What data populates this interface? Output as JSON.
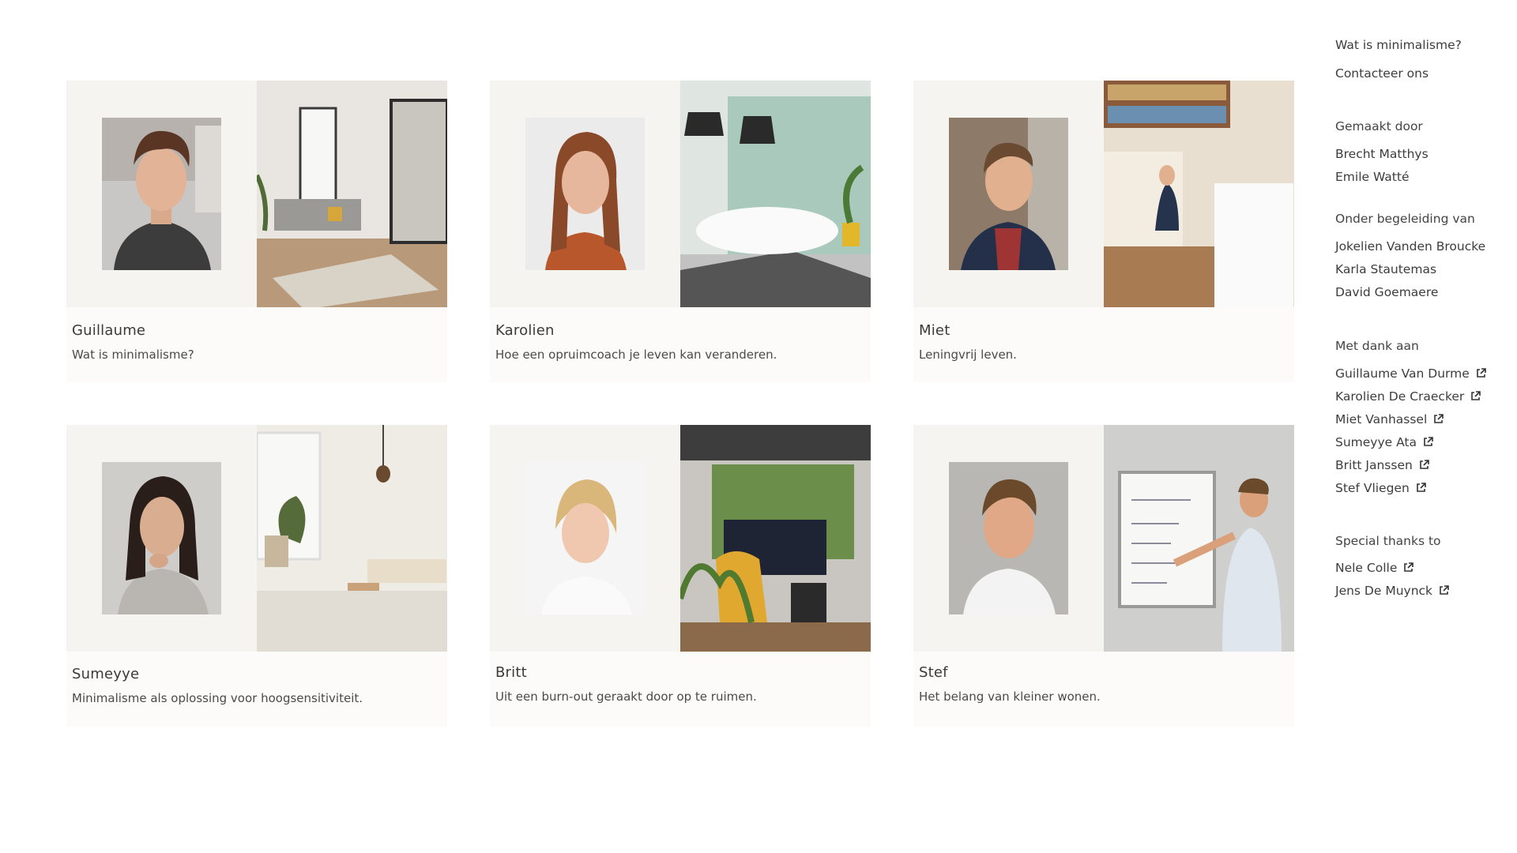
{
  "cards": [
    {
      "name": "Guillaume",
      "subtitle": "Wat is minimalisme?"
    },
    {
      "name": "Karolien",
      "subtitle": "Hoe een opruimcoach je leven kan veranderen."
    },
    {
      "name": "Miet",
      "subtitle": "Leningvrij leven."
    },
    {
      "name": "Sumeyye",
      "subtitle": "Minimalisme als oplossing voor hoogsensitiviteit."
    },
    {
      "name": "Britt",
      "subtitle": "Uit een burn-out geraakt door op te ruimen."
    },
    {
      "name": "Stef",
      "subtitle": "Het belang van kleiner wonen."
    }
  ],
  "sidebar": {
    "nav": [
      "Wat is minimalisme?",
      "Contacteer ons"
    ],
    "made_by_heading": "Gemaakt door",
    "made_by": [
      "Brecht Matthys",
      "Emile Watté"
    ],
    "guidance_heading": "Onder begeleiding van",
    "guidance": [
      "Jokelien Vanden Broucke",
      "Karla Stautemas",
      "David Goemaere"
    ],
    "thanks_heading": "Met dank aan",
    "thanks": [
      "Guillaume Van Durme",
      "Karolien De Craecker",
      "Miet Vanhassel",
      "Sumeyye Ata",
      "Britt Janssen",
      "Stef Vliegen"
    ],
    "special_heading": "Special thanks to",
    "special": [
      "Nele Colle",
      "Jens De Muynck"
    ]
  },
  "icons": {
    "external_link": "external-link-icon"
  },
  "colors": {
    "card_bg": "#fcfbf9",
    "portrait_pane": "#f6f4f1",
    "text": "#3b3b3b"
  }
}
